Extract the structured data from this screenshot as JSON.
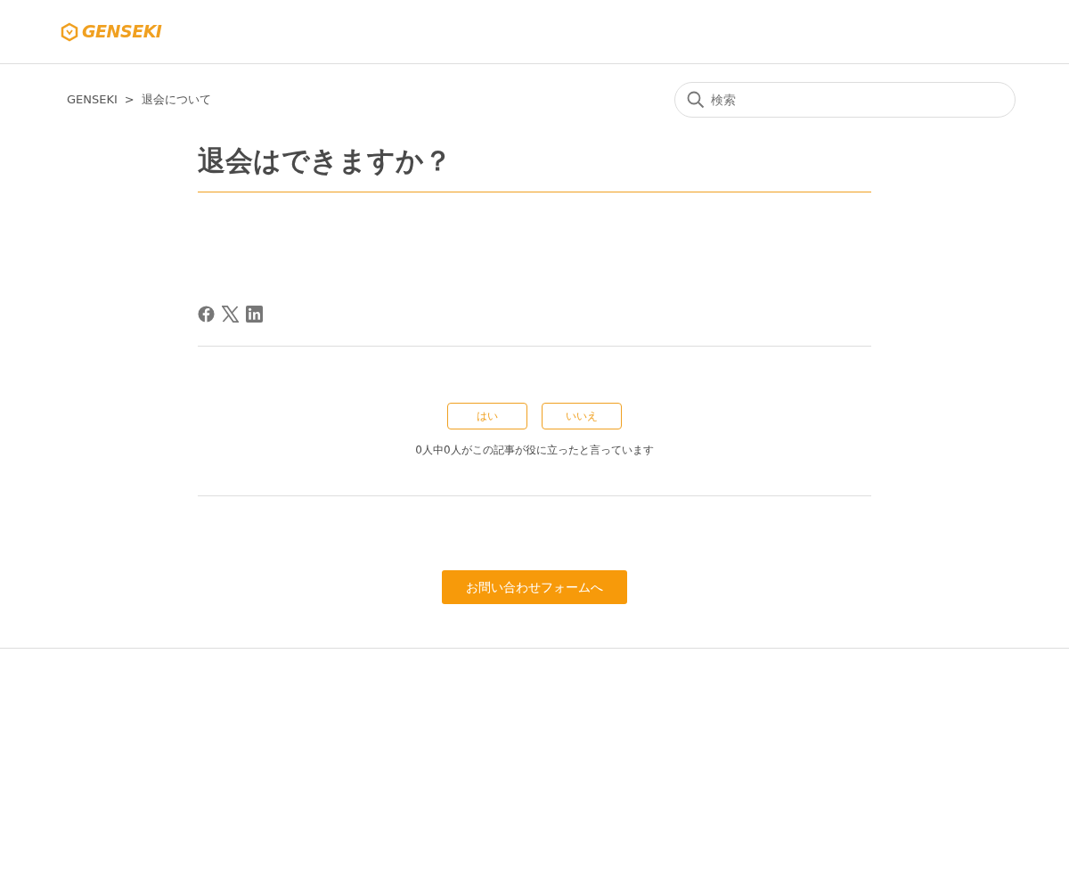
{
  "header": {
    "logo_text": "GENSEKI"
  },
  "breadcrumb": {
    "items": [
      "GENSEKI",
      "退会について"
    ],
    "separator": ">"
  },
  "search": {
    "placeholder": "検索"
  },
  "article": {
    "title": "退会はできますか？"
  },
  "vote": {
    "buttons": [
      "はい",
      "いいえ"
    ],
    "summary": "0人中0人がこの記事が役に立ったと言っています"
  },
  "contact_button": "お問い合わせフォームへ"
}
